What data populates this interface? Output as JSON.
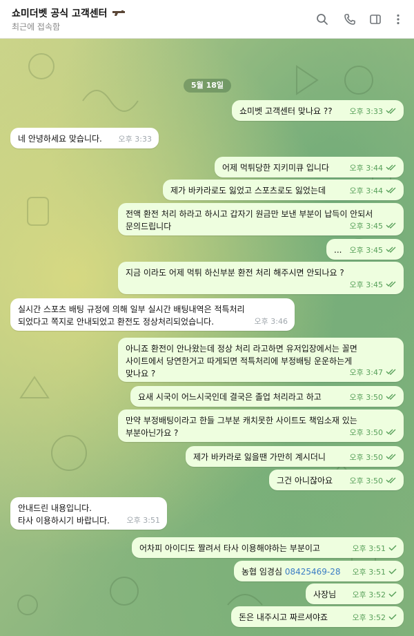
{
  "header": {
    "title": "쇼미더벳 공식 고객센터",
    "status": "최근에 접속함",
    "icons": [
      "search-icon",
      "phone-icon",
      "sidebar-icon",
      "more-vertical-icon"
    ]
  },
  "chat": {
    "date": "5월 18일",
    "messages": [
      {
        "dir": "out",
        "lines": [
          "쇼미벳 고객센터 맞나요 ??"
        ],
        "time": "오후 3:33",
        "status": "read"
      },
      {
        "dir": "in",
        "lines": [
          "네 안녕하세요 맞습니다."
        ],
        "time": "오후 3:33"
      },
      {
        "dir": "out",
        "lines": [
          "어제 먹튀당한 지키미큐 입니다"
        ],
        "time": "오후 3:44",
        "status": "read"
      },
      {
        "dir": "out",
        "lines": [
          "제가 바카라로도 잃었고 스포츠로도 잃었는데"
        ],
        "time": "오후 3:44",
        "status": "read"
      },
      {
        "dir": "out",
        "lines": [
          "전액 환전 처리 하라고 하시고 갑자기 원금만 보낸 부분이 납득이 안되서",
          "문의드립니다"
        ],
        "time": "오후 3:45",
        "status": "read"
      },
      {
        "dir": "out",
        "lines": [
          "..."
        ],
        "time": "오후 3:45",
        "status": "read"
      },
      {
        "dir": "out",
        "lines": [
          "지금 이라도 어제 먹튀 하신부분 환전 처리 해주시면 안되나요 ?"
        ],
        "time": "오후 3:45",
        "status": "read"
      },
      {
        "dir": "in",
        "lines": [
          "실시간 스포츠 배팅 규정에 의해 일부 실시간 배팅내역은 적특처리",
          "되었다고 쪽지로 안내되었고 환전도 정상처리되었습니다."
        ],
        "time": "오후 3:46"
      },
      {
        "dir": "out",
        "lines": [
          "아니죠 환전이 안나왔는데 정상 처리 라고하면 유저입장에서는 꼴면",
          "사이트에서 당연한거고 따게되면 적특처리에 부정배팅 운운하는게",
          "맞나요 ?"
        ],
        "time": "오후 3:47",
        "status": "read"
      },
      {
        "dir": "out",
        "lines": [
          "요새 시국이 어느시국인데 결국은 졸업 처리라고 하고"
        ],
        "time": "오후 3:50",
        "status": "read"
      },
      {
        "dir": "out",
        "lines": [
          "만약 부정배팅이라고 한들 그부분 캐치못한 사이트도 책임소재 있는",
          "부분아닌가요 ?"
        ],
        "time": "오후 3:50",
        "status": "read"
      },
      {
        "dir": "out",
        "lines": [
          "제가 바카라로 잃을땐 가만히 계시더니"
        ],
        "time": "오후 3:50",
        "status": "read"
      },
      {
        "dir": "out",
        "lines": [
          "그건 아니잖아요"
        ],
        "time": "오후 3:50",
        "status": "read"
      },
      {
        "dir": "in",
        "lines": [
          "안내드린 내용입니다.",
          "타사 이용하시기 바랍니다."
        ],
        "time": "오후 3:51"
      },
      {
        "dir": "out",
        "lines": [
          "어차피 아이디도 짤려서 타사 이용해야하는 부분이고"
        ],
        "time": "오후 3:51",
        "status": "sent"
      },
      {
        "dir": "out",
        "lines": [
          "농협 임경심 "
        ],
        "link": "08425469-28",
        "time": "오후 3:51",
        "status": "sent"
      },
      {
        "dir": "out",
        "lines": [
          "사장님"
        ],
        "time": "오후 3:52",
        "status": "sent"
      },
      {
        "dir": "out",
        "lines": [
          "돈은 내주시고 짜르셔야죠"
        ],
        "time": "오후 3:52",
        "status": "sent"
      }
    ]
  },
  "colors": {
    "outgoing_bubble": "#eefedf",
    "incoming_bubble": "#ffffff",
    "time_out": "#58a05a",
    "time_in": "#a0a7ad",
    "link": "#3a7cc4"
  }
}
